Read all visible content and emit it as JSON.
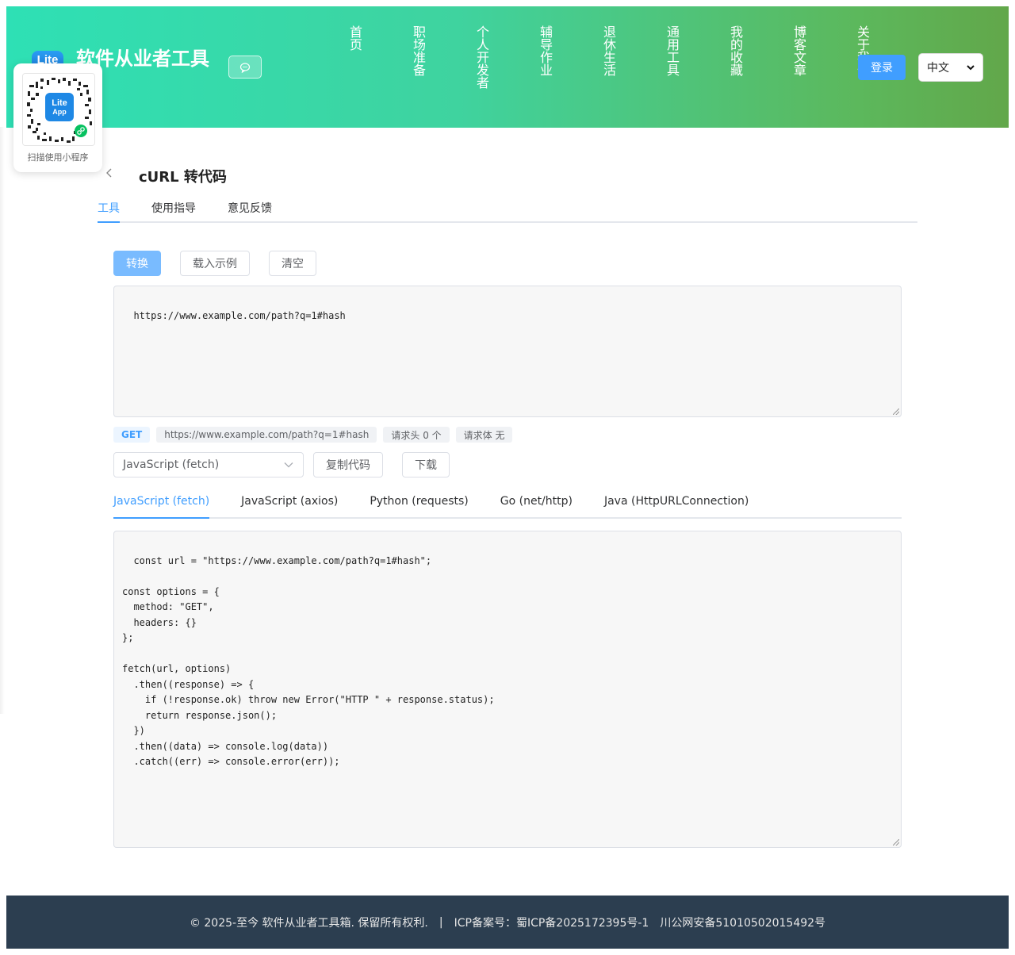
{
  "header": {
    "logo_text": "Lite",
    "brand": "软件从业者工具",
    "chat_icon": "chat-bubble-icon",
    "nav": [
      "首页",
      "职场准备",
      "个人开发者",
      "辅导作业",
      "退休生活",
      "通用工具",
      "我的收藏",
      "博客文章",
      "关于我们"
    ],
    "login_label": "登录",
    "language": "中文"
  },
  "qr": {
    "caption": "扫描使用小程序",
    "badge_line1": "Lite",
    "badge_line2": "App"
  },
  "page": {
    "back_icon": "chevron-left-icon",
    "title": "cURL 转代码",
    "tabs": [
      "工具",
      "使用指导",
      "意见反馈"
    ],
    "active_tab": "工具"
  },
  "toolbar": {
    "convert_label": "转换",
    "load_example_label": "载入示例",
    "clear_label": "清空"
  },
  "input": {
    "value": "https://www.example.com/path?q=1#hash"
  },
  "summary": {
    "method": "GET",
    "url": "https://www.example.com/path?q=1#hash",
    "headers": "请求头 0 个",
    "body": "请求体 无"
  },
  "output_controls": {
    "language_select": "JavaScript (fetch)",
    "copy_label": "复制代码",
    "download_label": "下载"
  },
  "language_tabs": [
    "JavaScript (fetch)",
    "JavaScript (axios)",
    "Python (requests)",
    "Go (net/http)",
    "Java (HttpURLConnection)"
  ],
  "active_language": "JavaScript (fetch)",
  "output": {
    "code": "const url = \"https://www.example.com/path?q=1#hash\";\n\nconst options = {\n  method: \"GET\",\n  headers: {}\n};\n\nfetch(url, options)\n  .then((response) => {\n    if (!response.ok) throw new Error(\"HTTP \" + response.status);\n    return response.json();\n  })\n  .then((data) => console.log(data))\n  .catch((err) => console.error(err));"
  },
  "footer": {
    "copyright": "© 2025-至今 软件从业者工具箱. 保留所有权利.",
    "separator": "|",
    "icp": "ICP备案号：蜀ICP备2025172395号-1",
    "police": "川公网安备51010502015492号"
  }
}
